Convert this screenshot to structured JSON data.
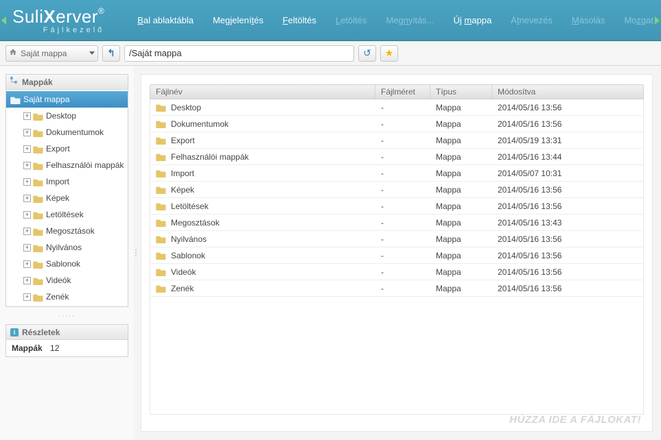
{
  "logo": {
    "line1_a": "Suli",
    "line1_b": "X",
    "line1_c": "erver",
    "line2": "Fájlkezelő"
  },
  "menu": [
    {
      "label_pre": "",
      "label_u": "B",
      "label_post": "al ablaktábla",
      "disabled": false
    },
    {
      "label_pre": "Megjelení",
      "label_u": "t",
      "label_post": "és",
      "disabled": false
    },
    {
      "label_pre": "",
      "label_u": "F",
      "label_post": "eltöltés",
      "disabled": false
    },
    {
      "label_pre": "",
      "label_u": "L",
      "label_post": "etöltés",
      "disabled": true
    },
    {
      "label_pre": "Meg",
      "label_u": "n",
      "label_post": "yitás...",
      "disabled": true
    },
    {
      "label_pre": "Új ",
      "label_u": "m",
      "label_post": "appa",
      "disabled": false
    },
    {
      "label_pre": "Á",
      "label_u": "t",
      "label_post": "nevezés",
      "disabled": true
    },
    {
      "label_pre": "",
      "label_u": "M",
      "label_post": "ásolás",
      "disabled": true
    },
    {
      "label_pre": "Mo",
      "label_u": "z",
      "label_post": "gat",
      "disabled": true
    }
  ],
  "toolbar": {
    "dropdown_label": "Saját mappa",
    "path_value": "/Saját mappa"
  },
  "sidebar": {
    "folders_title": "Mappák",
    "details_title": "Részletek",
    "details_label": "Mappák",
    "details_value": "12",
    "root": "Saját mappa",
    "items": [
      "Desktop",
      "Dokumentumok",
      "Export",
      "Felhasználói mappák",
      "Import",
      "Képek",
      "Letöltések",
      "Megosztások",
      "Nyilvános",
      "Sablonok",
      "Videók",
      "Zenék"
    ]
  },
  "table": {
    "columns": {
      "name": "Fájlnév",
      "size": "Fájlméret",
      "type": "Típus",
      "modified": "Módosítva"
    },
    "rows": [
      {
        "name": "Desktop",
        "size": "-",
        "type": "Mappa",
        "modified": "2014/05/16 13:56"
      },
      {
        "name": "Dokumentumok",
        "size": "-",
        "type": "Mappa",
        "modified": "2014/05/16 13:56"
      },
      {
        "name": "Export",
        "size": "-",
        "type": "Mappa",
        "modified": "2014/05/19 13:31"
      },
      {
        "name": "Felhasználói mappák",
        "size": "-",
        "type": "Mappa",
        "modified": "2014/05/16 13:44"
      },
      {
        "name": "Import",
        "size": "-",
        "type": "Mappa",
        "modified": "2014/05/07 10:31"
      },
      {
        "name": "Képek",
        "size": "-",
        "type": "Mappa",
        "modified": "2014/05/16 13:56"
      },
      {
        "name": "Letöltések",
        "size": "-",
        "type": "Mappa",
        "modified": "2014/05/16 13:56"
      },
      {
        "name": "Megosztások",
        "size": "-",
        "type": "Mappa",
        "modified": "2014/05/16 13:43"
      },
      {
        "name": "Nyilvános",
        "size": "-",
        "type": "Mappa",
        "modified": "2014/05/16 13:56"
      },
      {
        "name": "Sablonok",
        "size": "-",
        "type": "Mappa",
        "modified": "2014/05/16 13:56"
      },
      {
        "name": "Videók",
        "size": "-",
        "type": "Mappa",
        "modified": "2014/05/16 13:56"
      },
      {
        "name": "Zenék",
        "size": "-",
        "type": "Mappa",
        "modified": "2014/05/16 13:56"
      }
    ],
    "drop_hint": "HÚZZA IDE A FÁJLOKAT!"
  }
}
